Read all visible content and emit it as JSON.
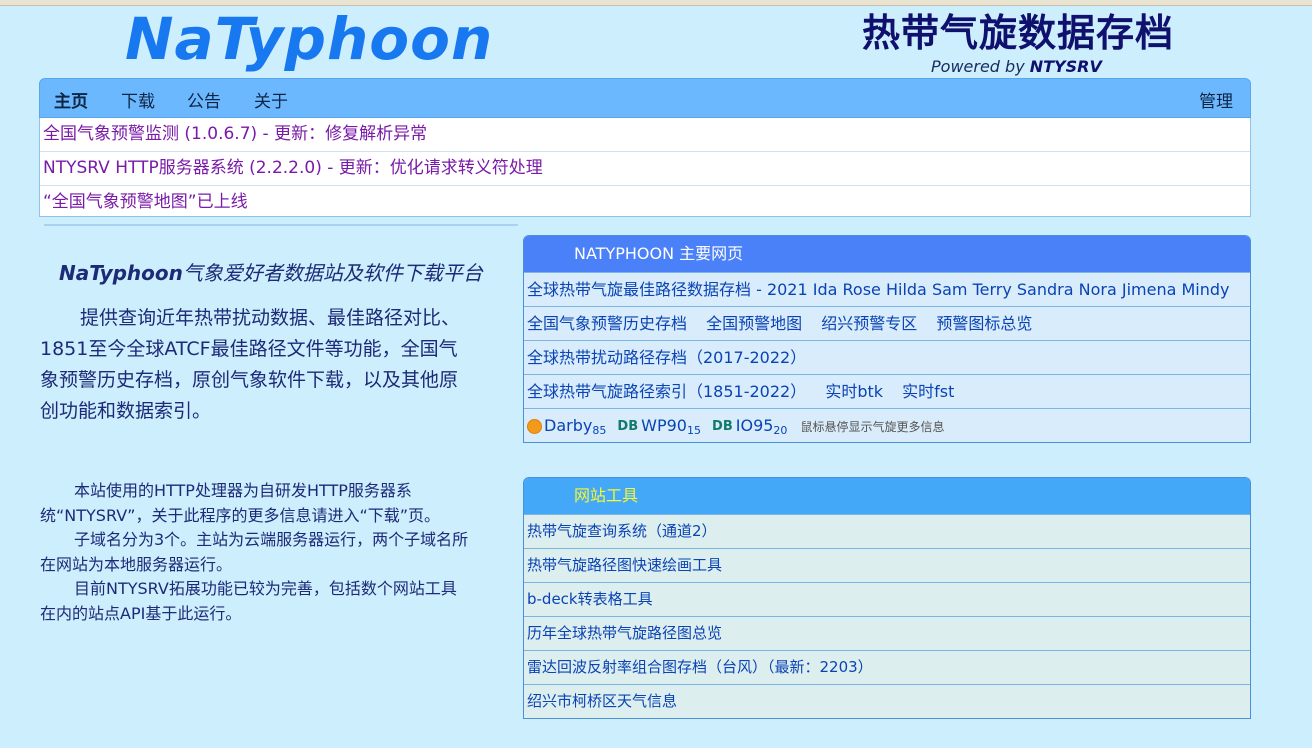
{
  "header": {
    "logo": "NaTyphoon",
    "cn_title": "热带气旋数据存档",
    "powered_prefix": "Powered by",
    "powered_brand": "NTYSRV"
  },
  "nav": {
    "items": [
      "主页",
      "下载",
      "公告",
      "关于"
    ],
    "admin": "管理"
  },
  "notices": [
    "全国气象预警监测 (1.0.6.7) - 更新：修复解析异常",
    "NTYSRV HTTP服务器系统 (2.2.2.0) - 更新：优化请求转义符处理",
    "“全国气象预警地图”已上线"
  ],
  "intro": {
    "title_brand": "NaTyphoon",
    "title_rest": "气象爱好者数据站及软件下载平台",
    "text": "提供查询近年热带扰动数据、最佳路径对比、1851至今全球ATCF最佳路径文件等功能，全国气象预警历史存档，原创气象软件下载，以及其他原创功能和数据索引。"
  },
  "about": [
    "本站使用的HTTP处理器为自研发HTTP服务器系统“NTYSRV”，关于此程序的更多信息请进入“下载”页。",
    "子域名分为3个。主站为云端服务器运行，两个子域名所在网站为本地服务器运行。",
    "目前NTYSRV拓展功能已较为完善，包括数个网站工具在内的站点API基于此运行。"
  ],
  "main_panel": {
    "title": "NATYPHOON 主要网页",
    "row1": "全球热带气旋最佳路径数据存档 - 2021 Ida Rose Hilda Sam Terry Sandra Nora Jimena Mindy",
    "row2": [
      "全国气象预警历史存档",
      "全国预警地图",
      "绍兴预警专区",
      "预警图标总览"
    ],
    "row3": "全球热带扰动路径存档（2017-2022）",
    "row4": [
      "全球热带气旋路径索引（1851-2022）",
      "实时btk",
      "实时fst"
    ],
    "storms": [
      {
        "name": "Darby",
        "sub": "85",
        "badge": ""
      },
      {
        "name": "WP90",
        "sub": "15",
        "badge": "DB"
      },
      {
        "name": "IO95",
        "sub": "20",
        "badge": "DB"
      }
    ],
    "storm_hint": "鼠标悬停显示气旋更多信息"
  },
  "tools_panel": {
    "title": "网站工具",
    "rows": [
      "热带气旋查询系统（通道2）",
      "热带气旋路径图快速绘画工具",
      "b-deck转表格工具",
      "历年全球热带气旋路径图总览",
      "雷达回波反射率组合图存档（台风）（最新：2203）",
      "绍兴市柯桥区天气信息"
    ]
  },
  "colors": {
    "background": "#cdeefc",
    "logo": "#1878f0",
    "navbar": "#6cb8ff",
    "notice_text": "#7a1aa8",
    "panel_header": "#4a80f8",
    "tools_header": "#43a8f7",
    "tools_header_text": "#f7f735",
    "link": "#0a43b5"
  }
}
